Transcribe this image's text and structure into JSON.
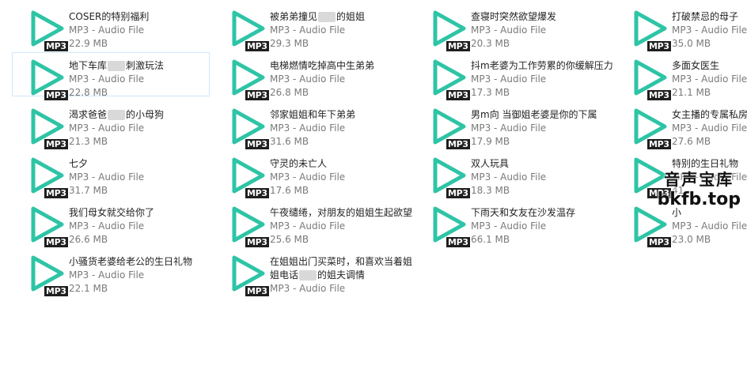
{
  "accent_color": "#2ec4a6",
  "icon_name": "play-triangle-icon",
  "files": [
    {
      "name": "COSER的特别福利",
      "type": "MP3 - Audio File",
      "size": "22.9 MB",
      "badge": "MP3"
    },
    {
      "name": "被弟弟撞见[redacted]的姐姐",
      "type": "MP3 - Audio File",
      "size": "29.3 MB",
      "badge": "MP3"
    },
    {
      "name": "查寝时突然欲望爆发",
      "type": "MP3 - Audio File",
      "size": "20.3 MB",
      "badge": "MP3"
    },
    {
      "name": "打破禁忌的母子",
      "type": "MP3 - Audio File",
      "size": "35.0 MB",
      "badge": "MP3"
    },
    {
      "name": "地下车库[redacted]刺激玩法",
      "type": "MP3 - Audio File",
      "size": "22.8 MB",
      "badge": "MP3"
    },
    {
      "name": "电梯燃情吃掉高中生弟弟",
      "type": "MP3 - Audio File",
      "size": "26.8 MB",
      "badge": "MP3"
    },
    {
      "name": "抖m老婆为工作劳累的你缓解压力",
      "type": "MP3 - Audio File",
      "size": "17.3 MB",
      "badge": "MP3"
    },
    {
      "name": "多面女医生",
      "type": "MP3 - Audio File",
      "size": "21.1 MB",
      "badge": "MP3"
    },
    {
      "name": "渴求爸爸[redacted]的小母狗",
      "type": "MP3 - Audio File",
      "size": "21.3 MB",
      "badge": "MP3"
    },
    {
      "name": "邻家姐姐和年下弟弟",
      "type": "MP3 - Audio File",
      "size": "31.6 MB",
      "badge": "MP3"
    },
    {
      "name": "男m向 当御姐老婆是你的下属",
      "type": "MP3 - Audio File",
      "size": "17.9 MB",
      "badge": "MP3"
    },
    {
      "name": "女主播的专属私房",
      "type": "MP3 - Audio File",
      "size": "27.6 MB",
      "badge": "MP3"
    },
    {
      "name": "七夕",
      "type": "MP3 - Audio File",
      "size": "31.7 MB",
      "badge": "MP3"
    },
    {
      "name": "守灵的未亡人",
      "type": "MP3 - Audio File",
      "size": "17.6 MB",
      "badge": "MP3"
    },
    {
      "name": "双人玩具",
      "type": "MP3 - Audio File",
      "size": "18.3 MB",
      "badge": "MP3"
    },
    {
      "name": "特别的生日礼物",
      "type": "MP3 - Audio File",
      "size": "41.",
      "badge": "MP3"
    },
    {
      "name": "我们母女就交给你了",
      "type": "MP3 - Audio File",
      "size": "26.6 MB",
      "badge": "MP3"
    },
    {
      "name": "午夜缱绻，对朋友的姐姐生起欲望",
      "type": "MP3 - Audio File",
      "size": "25.6 MB",
      "badge": "MP3"
    },
    {
      "name": "下雨天和女友在沙发温存",
      "type": "MP3 - Audio File",
      "size": "66.1 MB",
      "badge": "MP3"
    },
    {
      "name": "小",
      "type": "MP3 - Audio File",
      "size": "23.0 MB",
      "badge": "MP3"
    },
    {
      "name": "小骚货老婆给老公的生日礼物",
      "type": "MP3 - Audio File",
      "size": "22.1 MB",
      "badge": "MP3"
    },
    {
      "name": "在姐姐出门买菜时，和喜欢当着姐姐电话[redacted]的姐夫调情",
      "type": "MP3 - Audio File",
      "size": "",
      "badge": "MP3"
    }
  ],
  "watermark": {
    "line1": "音声宝库",
    "line2": "bkfb.top"
  }
}
